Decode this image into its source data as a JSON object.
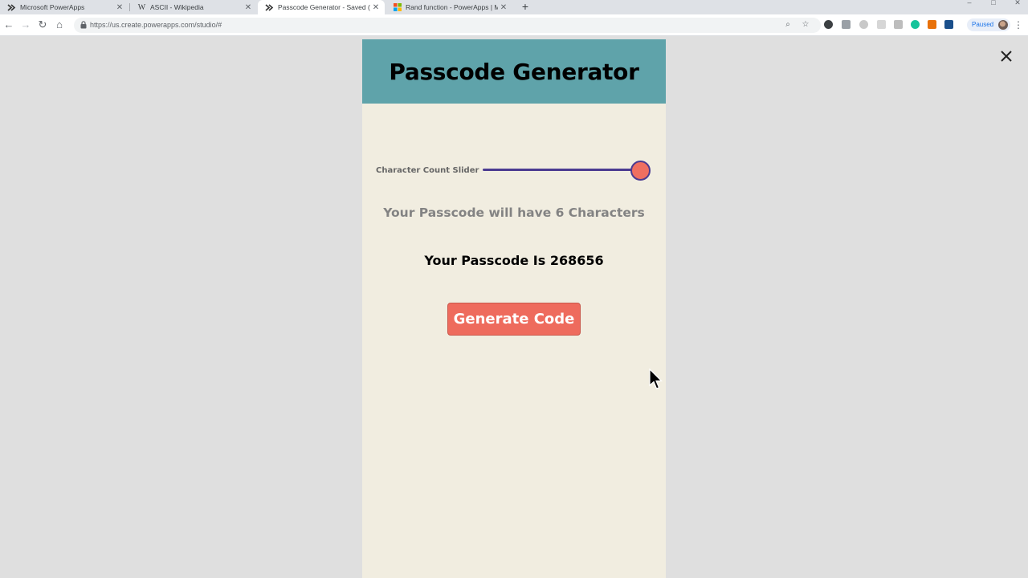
{
  "browser": {
    "tabs": [
      {
        "title": "Microsoft PowerApps",
        "favicon": "powerapps-icon",
        "active": false
      },
      {
        "title": "ASCII - Wikipedia",
        "favicon": "wikipedia-icon",
        "active": false
      },
      {
        "title": "Passcode Generator - Saved (Un",
        "favicon": "powerapps-icon",
        "active": true
      },
      {
        "title": "Rand function - PowerApps | Mic",
        "favicon": "microsoft-icon",
        "active": false
      }
    ],
    "url": "https://us.create.powerapps.com/studio/#",
    "profile_status": "Paused"
  },
  "app": {
    "title": "Passcode Generator",
    "slider_label": "Character Count Slider",
    "slider_value_fraction": 1.0,
    "character_info": "Your Passcode will have 6 Characters",
    "passcode_result": "Your Passcode Is 268656",
    "generate_button_label": "Generate Code"
  },
  "colors": {
    "header": "#5fa3aa",
    "screen_background": "#f1ede0",
    "button": "#ee6b5d",
    "slider_rail": "#4b3b91",
    "slider_thumb": "#ef6f60"
  }
}
